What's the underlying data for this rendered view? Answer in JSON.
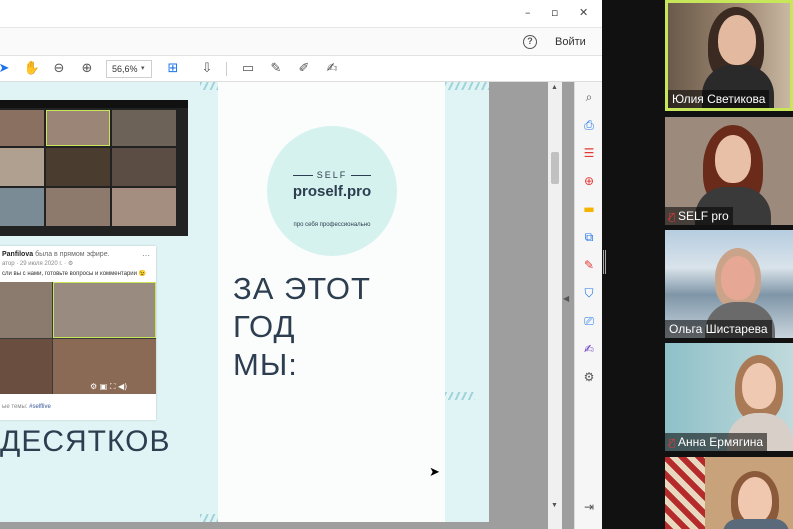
{
  "viewer": {
    "window_controls": {
      "minimize": "–",
      "maximize": "▫",
      "close": "✕"
    },
    "menu": {
      "help_label": "?",
      "signin_label": "Войти"
    },
    "toolbar": {
      "zoom_value": "56,6%",
      "zoom_arrow": "▾"
    }
  },
  "slide": {
    "post": {
      "author": "Panfilova",
      "action": "была в прямом эфире.",
      "date": "атор · 29 июля 2020 г. · ⚙",
      "text": "сли вы с нами, готовьте вопросы и комментарии 😉",
      "more": "···",
      "tag_prefix": "ые темы:",
      "tag": "#selflive"
    },
    "left_heading": "ДЕСЯТКОВ",
    "logo": {
      "self": "SELF",
      "name": "proself.pro",
      "tagline": "про себя профессионально"
    },
    "title_line1": "ЗА ЭТОТ ГОД",
    "title_line2": "МЫ:"
  },
  "gallery": {
    "participants": [
      {
        "name": "Юлия Светикова",
        "muted": false,
        "active": true
      },
      {
        "name": "SELF pro",
        "muted": true,
        "active": false
      },
      {
        "name": "Ольга Шистарева",
        "muted": false,
        "active": false
      },
      {
        "name": "Анна Ермягина",
        "muted": true,
        "active": false
      },
      {
        "name": "",
        "muted": false,
        "active": false
      }
    ]
  },
  "colors": {
    "slide_bg": "#e0f4f6",
    "slide_text": "#2c3e50",
    "logo_circle": "#d6f2ee",
    "active_speaker": "#c8e65a",
    "muted_icon": "#e53935"
  }
}
